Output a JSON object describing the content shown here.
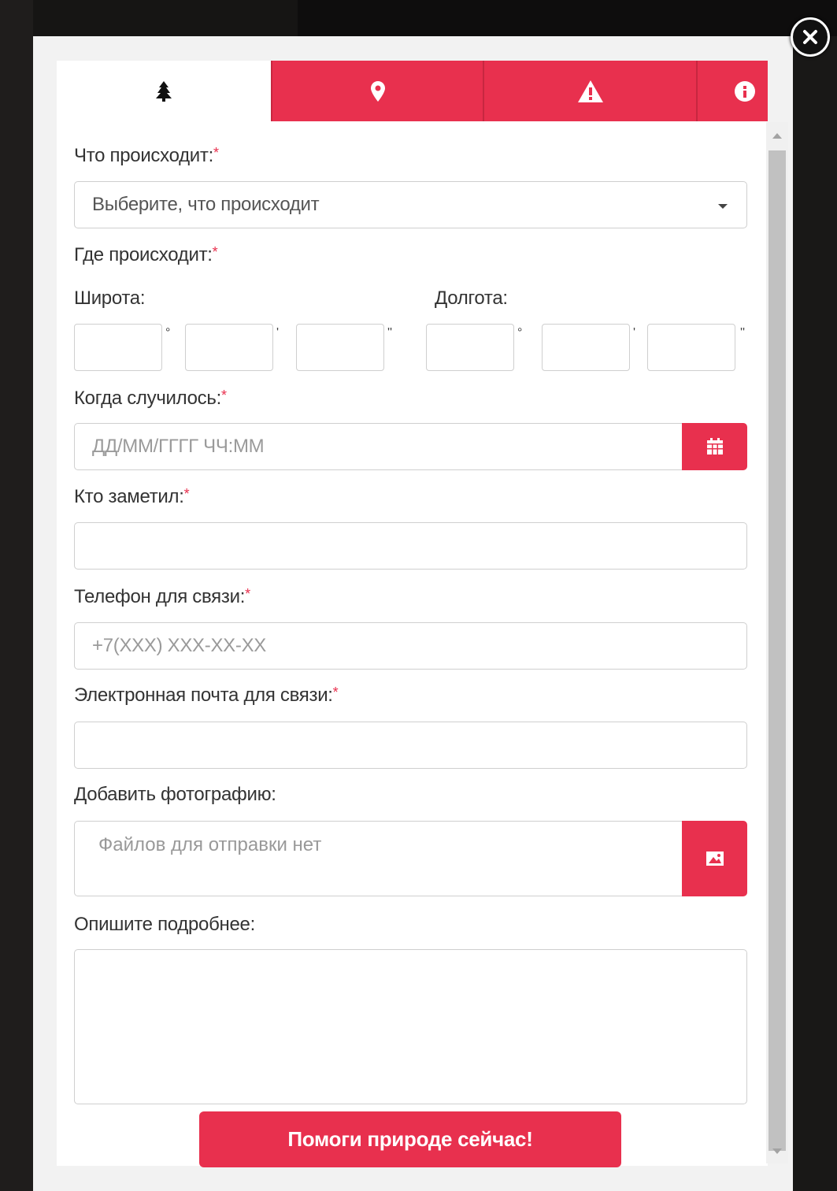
{
  "tabs": [
    {
      "icon": "tree-icon",
      "active": true
    },
    {
      "icon": "map-marker-icon",
      "active": false
    },
    {
      "icon": "warning-icon",
      "active": false
    },
    {
      "icon": "info-icon",
      "active": false
    }
  ],
  "colors": {
    "accent": "#e8304e",
    "accent_dark": "#c72740",
    "required": "#e8304e"
  },
  "form": {
    "what_label": "Что происходит:",
    "what_select_value": "Выберите, что происходит",
    "where_label": "Где происходит:",
    "latitude_label": "Широта:",
    "longitude_label": "Долгота:",
    "degree_mark": "°",
    "minute_mark": "'",
    "second_mark": "''",
    "when_label": "Когда случилось:",
    "when_placeholder": "ДД/ММ/ГГГГ ЧЧ:ММ",
    "who_label": "Кто заметил:",
    "phone_label": "Телефон для связи:",
    "phone_placeholder": "+7(XXX) XXX-XX-XX",
    "email_label": "Электронная почта для связи:",
    "photo_label": "Добавить фотографию:",
    "photo_status": "Файлов для отправки нет",
    "describe_label": "Опишите подробнее:",
    "required_mark": "*",
    "submit_label": "Помоги природе сейчас!"
  }
}
